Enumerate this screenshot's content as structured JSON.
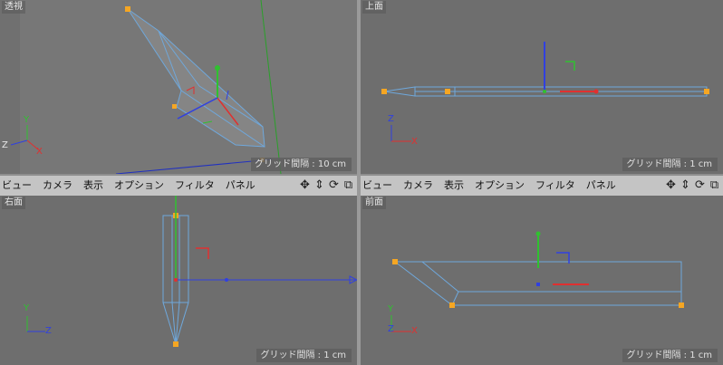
{
  "viewports": {
    "perspective": {
      "label": "透視",
      "grid": "グリッド間隔 : 10 cm"
    },
    "top": {
      "label": "上面",
      "grid": "グリッド間隔 : 1 cm"
    },
    "right": {
      "label": "右面",
      "grid": "グリッド間隔 : 1 cm"
    },
    "front": {
      "label": "前面",
      "grid": "グリッド間隔 : 1 cm"
    }
  },
  "menu": {
    "left": [
      "ビュー",
      "カメラ",
      "表示",
      "オプション",
      "フィルタ",
      "パネル"
    ],
    "right": [
      "ビュー",
      "カメラ",
      "表示",
      "オプション",
      "フィルタ",
      "パネル"
    ]
  },
  "tools": {
    "move": "✥",
    "dolly": "⇕",
    "rotate": "⟳",
    "maximize": "⧉"
  },
  "axes": {
    "x": "X",
    "y": "Y",
    "z": "Z"
  },
  "colors": {
    "viewport_bg": "#6e6e6e",
    "wire": "#6fa8dc",
    "point": "#f5a623",
    "x_axis": "#e03030",
    "y_axis": "#30c030",
    "z_axis": "#3040e0"
  }
}
